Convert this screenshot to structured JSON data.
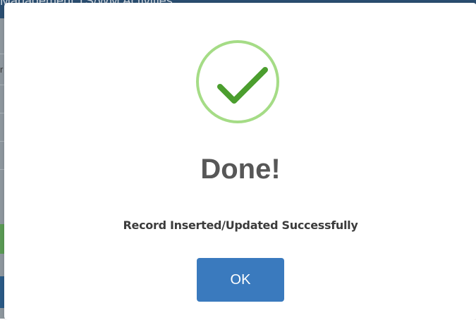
{
  "background": {
    "title_fragment": "Management TS/WM Activities",
    "cell_fragment": "r",
    "header_color": "#2b4f72"
  },
  "dialog": {
    "icon": "checkmark-icon",
    "icon_color": "#4b9e2e",
    "icon_ring_color": "#a5dc86",
    "title": "Done!",
    "message": "Record Inserted/Updated Successfully",
    "ok_label": "OK",
    "button_color": "#3a7abe"
  }
}
